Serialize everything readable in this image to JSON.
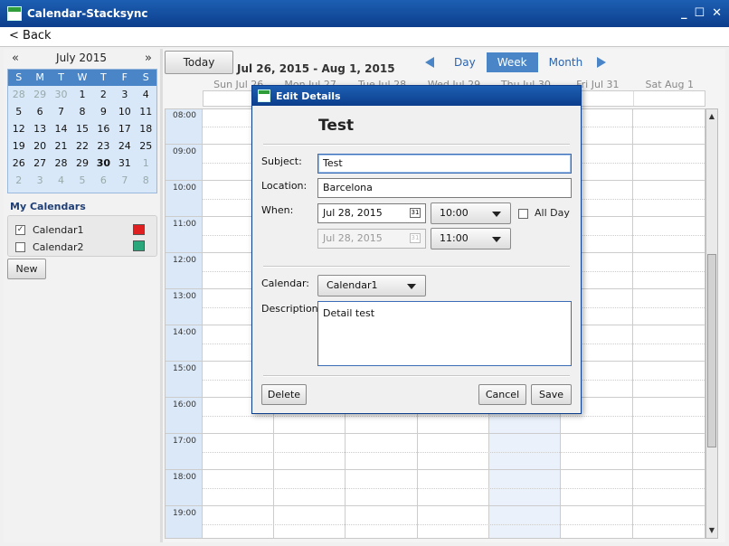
{
  "window": {
    "title": "Calendar-Stacksync",
    "controls": {
      "minimize": "_",
      "maximize": "☐",
      "close": "✕"
    }
  },
  "topbar": {
    "back_label": "< Back"
  },
  "minical": {
    "prev": "«",
    "next": "»",
    "month_label": "July 2015",
    "weekdays": [
      "S",
      "M",
      "T",
      "W",
      "T",
      "F",
      "S"
    ],
    "weeks": [
      [
        "28",
        "29",
        "30",
        "1",
        "2",
        "3",
        "4"
      ],
      [
        "5",
        "6",
        "7",
        "8",
        "9",
        "10",
        "11"
      ],
      [
        "12",
        "13",
        "14",
        "15",
        "16",
        "17",
        "18"
      ],
      [
        "19",
        "20",
        "21",
        "22",
        "23",
        "24",
        "25"
      ],
      [
        "26",
        "27",
        "28",
        "29",
        "30",
        "31",
        "1"
      ],
      [
        "2",
        "3",
        "4",
        "5",
        "6",
        "7",
        "8"
      ]
    ]
  },
  "my_calendars": {
    "heading": "My Calendars",
    "items": [
      {
        "label": "Calendar1",
        "checked": true,
        "color": "#e02020"
      },
      {
        "label": "Calendar2",
        "checked": false,
        "color": "#2aa87c"
      }
    ],
    "new_label": "New"
  },
  "toolbar": {
    "today_label": "Today",
    "date_range": "Jul 26, 2015 - Aug 1, 2015",
    "views": [
      "Day",
      "Week",
      "Month"
    ],
    "active_view": "Week"
  },
  "week": {
    "days": [
      "Sun Jul 26",
      "Mon Jul 27",
      "Tue Jul 28",
      "Wed Jul 29",
      "Thu Jul 30",
      "Fri Jul 31",
      "Sat Aug 1"
    ],
    "hours": [
      "08:00",
      "09:00",
      "10:00",
      "11:00",
      "12:00",
      "13:00",
      "14:00",
      "15:00",
      "16:00",
      "17:00",
      "18:00",
      "19:00"
    ]
  },
  "dialog": {
    "title": "Edit Details",
    "heading": "Test",
    "subject_label": "Subject:",
    "subject_value": "Test",
    "location_label": "Location:",
    "location_value": "Barcelona",
    "when_label": "When:",
    "start_date": "Jul 28, 2015",
    "start_time": "10:00",
    "end_date": "Jul 28, 2015",
    "end_time": "11:00",
    "allday_label": "All Day",
    "calendar_label": "Calendar:",
    "calendar_value": "Calendar1",
    "description_label": "Description:",
    "description_value": "Detail test",
    "delete_label": "Delete",
    "cancel_label": "Cancel",
    "save_label": "Save"
  },
  "colors": {
    "titlebar": "#0c3e8c",
    "accent": "#4a86c7",
    "gutter": "#dae8f8"
  }
}
